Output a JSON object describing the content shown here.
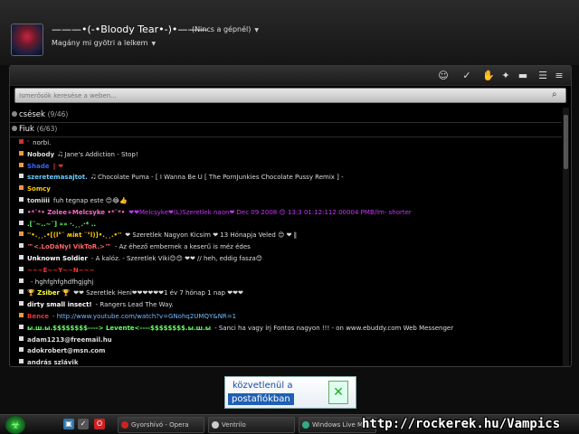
{
  "profile": {
    "display_name": "———•(-•Bloody Tear•-)•———",
    "status": "(Nincs a gépnél)",
    "personal_message": "Magány mi gyötri a lelkem"
  },
  "search": {
    "placeholder": "Ismerősök keresése a weben..."
  },
  "groups": [
    {
      "name": "csések",
      "count": "(9/46)"
    },
    {
      "name": "Fiuk",
      "count": "(6/63)"
    }
  ],
  "contacts": [
    {
      "status": "red",
      "name": "'",
      "message": "norbi.",
      "name_color": "#e33",
      "msg_color": "#ddd"
    },
    {
      "status": "orange",
      "name": "Nobody",
      "message": "🎝 Jane's Addiction - Stop!",
      "name_color": "#ddd",
      "msg_color": "#ddd"
    },
    {
      "status": "orange",
      "name": "Shade",
      "message": "‖ ❤",
      "name_color": "#36f",
      "msg_color": "#c33"
    },
    {
      "status": "white",
      "name": "szeretemasajtot.",
      "message": "🎝 Chocolate Puma - [ I Wanna Be U [ The PornJunkies Chocolate Pussy Remix ] -",
      "name_color": "#6cf",
      "msg_color": "#ddd"
    },
    {
      "status": "orange",
      "name": "Somcy",
      "message": "",
      "name_color": "#fc0",
      "msg_color": "#ddd"
    },
    {
      "status": "white",
      "name": "tomiiii",
      "message": "fuh tegnap este 😊😂👍",
      "name_color": "#ddd",
      "msg_color": "#ddd"
    },
    {
      "status": "white",
      "name": "•*¨*• Zolee+Melcsyke •*¨*•",
      "message": "❤❤Melcsyke❤(L)Szeretlek naon❤  Dec 09 2008 😊 13:3 01:12:112:00004 PMB/lm- shorter",
      "name_color": "#f6c",
      "msg_color": "#c3f"
    },
    {
      "status": "white",
      "name": ".[¨~..~¨] »» ·.¸¸.·* ..",
      "message": "",
      "name_color": "#6f6",
      "msg_color": "#ddd"
    },
    {
      "status": "orange",
      "name": "''•.¸¸.•[(l°¨ ʍiʀt ¨°l)]•.¸¸.•''",
      "message": "❤ Szeretlek Nagyon Kicsim ❤ 13 Hónapja Veled 😊 ❤ ‖",
      "name_color": "#fc0",
      "msg_color": "#ddd"
    },
    {
      "status": "white",
      "name": "™<.LoDáNyI VikToR.>™",
      "message": "- Az éhező embernek a keserű is méz édes",
      "name_color": "#f66",
      "msg_color": "#ddd"
    },
    {
      "status": "white",
      "name": "Unknown Soldier",
      "message": "- A kalóz. - Szeretlek Viki😊😊 ❤❤ // heh, eddig fasza😊",
      "name_color": "#fff",
      "msg_color": "#ddd"
    },
    {
      "status": "white",
      "name": "~~~E~~Y~~N~~~",
      "message": "",
      "name_color": "#f33",
      "msg_color": "#ddd"
    },
    {
      "status": "white",
      "name": "",
      "message": "- hghfghfghdfhgjghj",
      "name_color": "#ddd",
      "msg_color": "#ddd"
    },
    {
      "status": "white",
      "name": "🏆 Zsiber 🏆",
      "message": "❤❤ Szeretlek Heni❤❤❤❤❤❤1 év 7 hónap 1 nap ❤❤❤",
      "name_color": "#ff3",
      "msg_color": "#ddd"
    },
    {
      "status": "white",
      "name": "dirty small insect!",
      "message": "- Rangers Lead The Way.",
      "name_color": "#fff",
      "msg_color": "#ddd"
    },
    {
      "status": "orange",
      "name": "Bence",
      "message": "- http://www.youtube.com/watch?v=GNohq2UMQY&NR=1",
      "name_color": "#e33",
      "msg_color": "#7bf"
    },
    {
      "status": "white",
      "name": "ы.ш.ы.$$$$$$$$----> Levente<----$$$$$$$$.ы.ш.ы",
      "message": "- Sanci ha vagy írj Fontos nagyon !!! - on www.ebuddy.com Web Messenger",
      "name_color": "#6f6",
      "msg_color": "#ddd"
    },
    {
      "status": "white",
      "name": "adam1213@freemail.hu",
      "message": "",
      "name_color": "#ddd",
      "msg_color": "#ddd"
    },
    {
      "status": "white",
      "name": "adokrobert@msn.com",
      "message": "",
      "name_color": "#ddd",
      "msg_color": "#ddd"
    },
    {
      "status": "white",
      "name": "andrás szlávik",
      "message": "",
      "name_color": "#ddd",
      "msg_color": "#ddd"
    }
  ],
  "ad": {
    "line1": "közvetlenül a",
    "line2": "postafiókban"
  },
  "taskbar": {
    "tasks": [
      "Gyorshívó - Opera",
      "Ventrilo",
      "Windows Live Mes"
    ]
  },
  "watermark": "http://rockerek.hu/Vampics"
}
